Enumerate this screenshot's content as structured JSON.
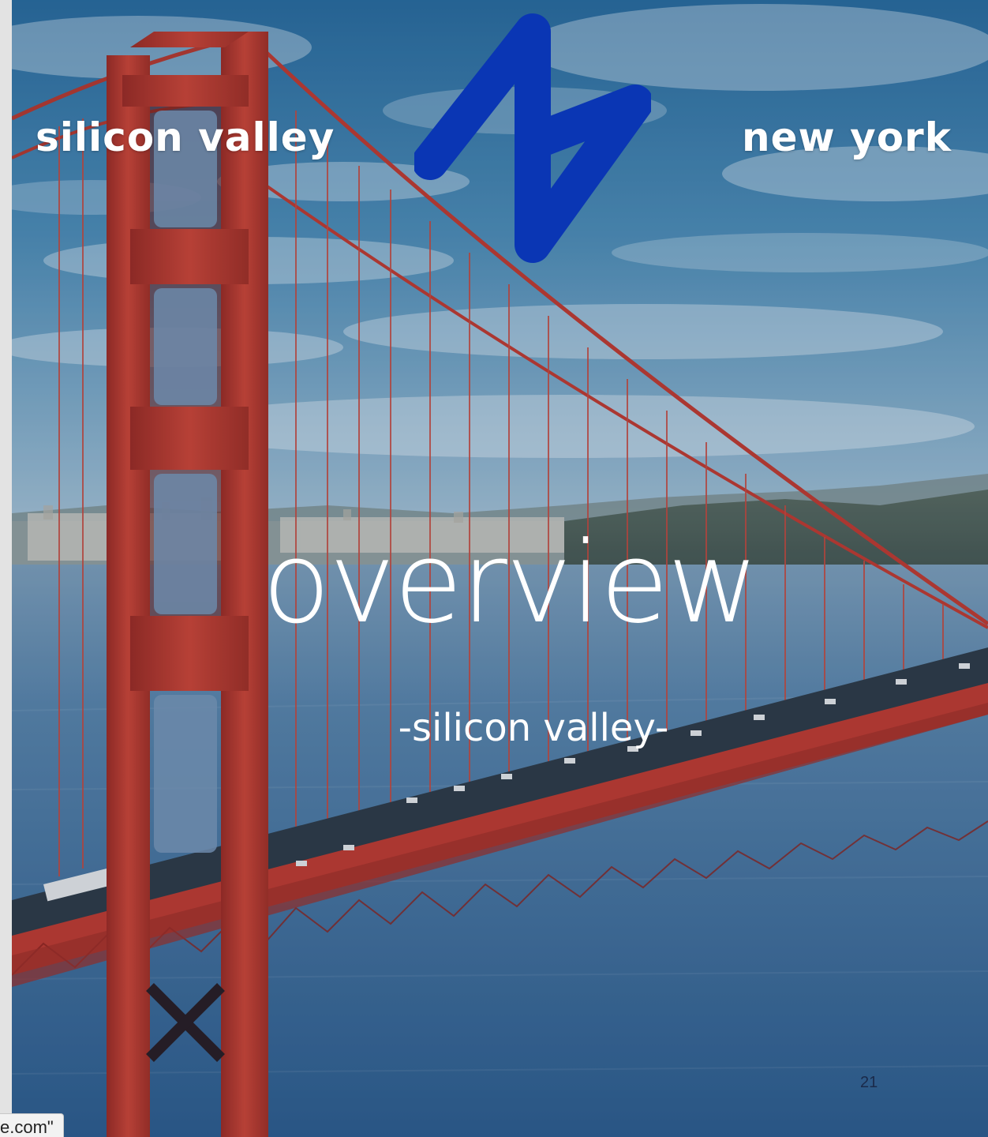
{
  "nav": {
    "left_label": "silicon valley",
    "right_label": "new york"
  },
  "logo": {
    "icon": "n-logo-icon",
    "color": "#0a36b4"
  },
  "hero": {
    "title": "overview",
    "subtitle": "-silicon valley-"
  },
  "page_number": "21",
  "status_url": "e.com\"",
  "colors": {
    "sky_top": "#2a6ea0",
    "sky_bottom": "#8fb3cc",
    "water": "#3f6f9e",
    "bridge_red": "#c4362a",
    "text": "#ffffff"
  }
}
